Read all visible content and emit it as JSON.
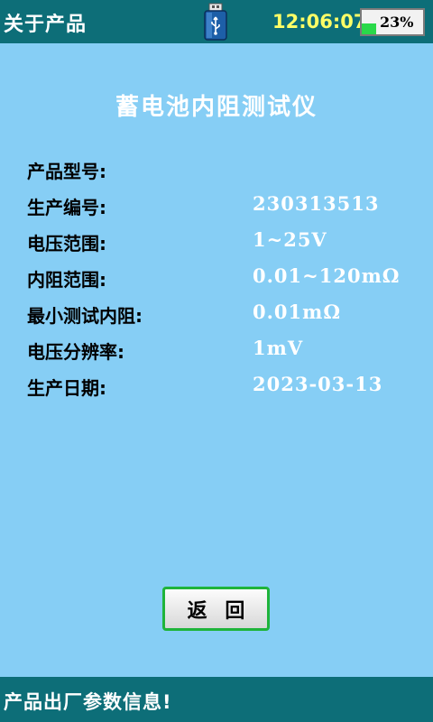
{
  "header": {
    "title": "关于产品",
    "usb_icon": "usb-icon",
    "time": "12:06:07",
    "battery_percent": "23%",
    "battery_level": 0.23,
    "colors": {
      "bar": "#0D6E78",
      "time": "#FFFF66",
      "battery_fill": "#2AD94A"
    }
  },
  "main": {
    "heading": "蓄电池内阻测试仪",
    "background": "#86CEF5",
    "rows": [
      {
        "label": "产品型号:",
        "value": ""
      },
      {
        "label": "生产编号:",
        "value": "230313513"
      },
      {
        "label": "电压范围:",
        "value": "1~25V"
      },
      {
        "label": "内阻范围:",
        "value": "0.01~120mΩ"
      },
      {
        "label": "最小测试内阻:",
        "value": "0.01mΩ"
      },
      {
        "label": "电压分辨率:",
        "value": "1mV"
      },
      {
        "label": "生产日期:",
        "value": "2023-03-13"
      }
    ]
  },
  "back_button": {
    "label": "返 回",
    "border_color": "#1FB43B"
  },
  "status_bar": {
    "text": "产品出厂参数信息!"
  }
}
